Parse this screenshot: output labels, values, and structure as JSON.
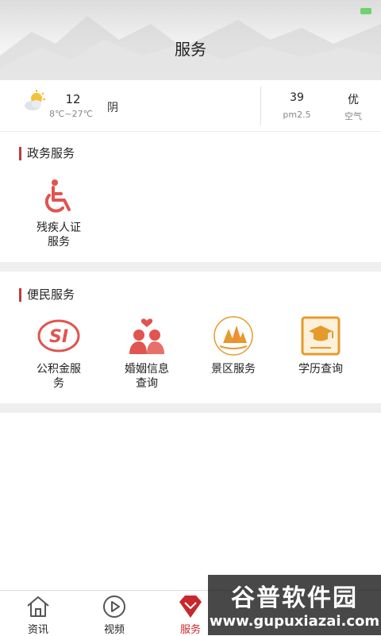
{
  "header": {
    "title": "服务"
  },
  "weather": {
    "icon": "partly-cloudy-icon",
    "temperature": "12",
    "range": "8℃~27℃",
    "condition": "阴",
    "aqi_value": "39",
    "aqi_label": "pm2.5",
    "quality_value": "优",
    "quality_label": "空气"
  },
  "gov_section": {
    "title": "政务服务",
    "items": [
      {
        "label_line1": "残疾人证",
        "label_line2": "服务",
        "icon": "wheelchair-icon"
      }
    ]
  },
  "civil_section": {
    "title": "便民服务",
    "items": [
      {
        "label_line1": "公积金服",
        "label_line2": "务",
        "icon": "social-security-icon"
      },
      {
        "label_line1": "婚姻信息",
        "label_line2": "查询",
        "icon": "couple-icon"
      },
      {
        "label_line1": "景区服务",
        "label_line2": "",
        "icon": "scenic-area-icon"
      },
      {
        "label_line1": "学历查询",
        "label_line2": "",
        "icon": "certificate-icon"
      }
    ]
  },
  "tabbar": {
    "tabs": [
      {
        "label": "资讯",
        "icon": "home-icon"
      },
      {
        "label": "视频",
        "icon": "play-icon"
      },
      {
        "label": "服务",
        "icon": "diamond-icon",
        "active": true
      },
      {
        "label": "",
        "icon": ""
      },
      {
        "label": "",
        "icon": ""
      }
    ]
  },
  "watermark": {
    "title": "谷普软件园",
    "url": "www.gupuxiazai.com"
  },
  "colors": {
    "accent": "#c8282c",
    "icon_red": "#e0554f",
    "icon_orange": "#e69a2e"
  }
}
